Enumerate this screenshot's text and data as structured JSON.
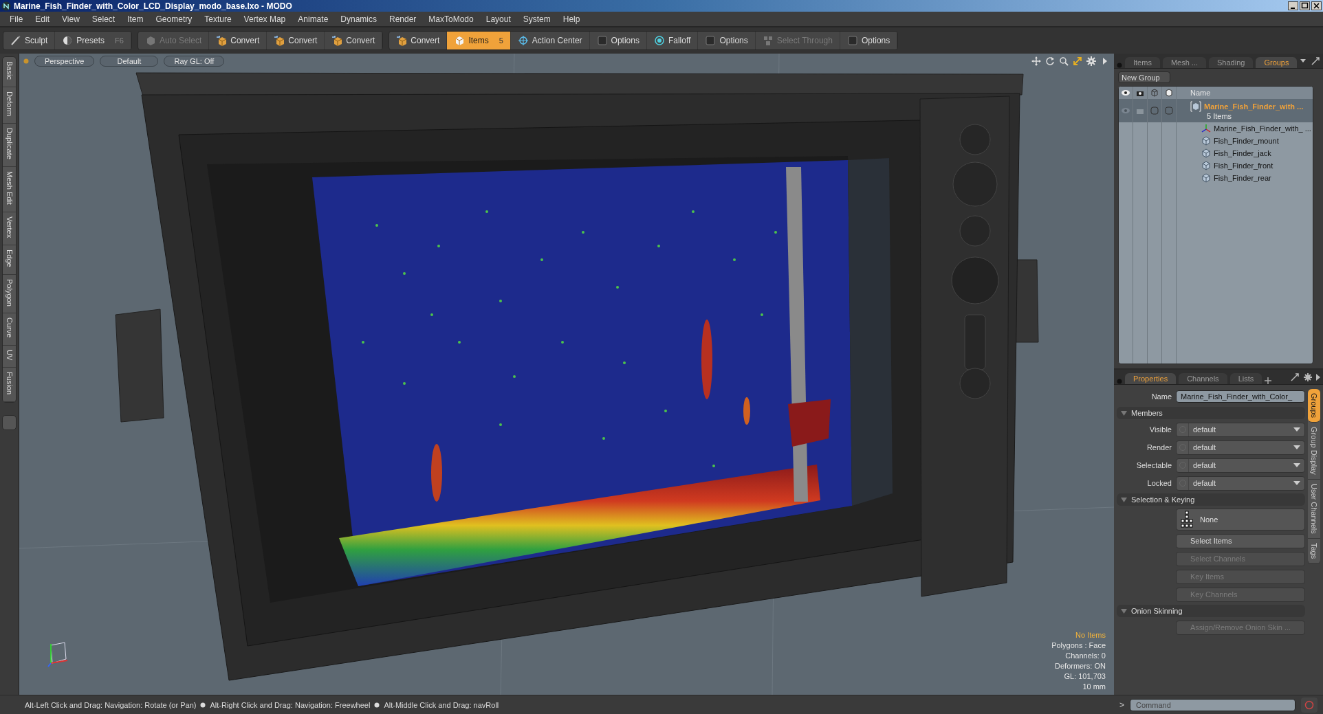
{
  "window": {
    "title": "Marine_Fish_Finder_with_Color_LCD_Display_modo_base.lxo - MODO"
  },
  "menu": [
    "File",
    "Edit",
    "View",
    "Select",
    "Item",
    "Geometry",
    "Texture",
    "Vertex Map",
    "Animate",
    "Dynamics",
    "Render",
    "MaxToModo",
    "Layout",
    "System",
    "Help"
  ],
  "toolbar": {
    "groups": [
      [
        {
          "kind": "sculpt",
          "label": "Sculpt",
          "selected": false,
          "disabled": false
        },
        {
          "kind": "presets",
          "label": "Presets",
          "shortcut": "F6",
          "selected": false,
          "disabled": false
        }
      ],
      [
        {
          "kind": "select",
          "label": "Auto Select",
          "selected": false,
          "disabled": true
        },
        {
          "kind": "convert",
          "label": "Convert",
          "selected": false,
          "disabled": false
        },
        {
          "kind": "convert",
          "label": "Convert",
          "selected": false,
          "disabled": false
        },
        {
          "kind": "convert",
          "label": "Convert",
          "selected": false,
          "disabled": false
        }
      ],
      [
        {
          "kind": "convert",
          "label": "Convert",
          "selected": false,
          "disabled": false
        },
        {
          "kind": "items",
          "label": "Items",
          "shortcut": "5",
          "selected": true,
          "disabled": false
        },
        {
          "kind": "action_center",
          "label": "Action Center",
          "selected": false,
          "disabled": false
        },
        {
          "kind": "options",
          "label": "Options",
          "selected": false,
          "disabled": false
        },
        {
          "kind": "falloff",
          "label": "Falloff",
          "selected": false,
          "disabled": false
        },
        {
          "kind": "options",
          "label": "Options",
          "selected": false,
          "disabled": false
        },
        {
          "kind": "select_through",
          "label": "Select Through",
          "selected": false,
          "disabled": true
        },
        {
          "kind": "options",
          "label": "Options",
          "selected": false,
          "disabled": false
        }
      ]
    ]
  },
  "side_tabs": [
    "Basic",
    "Deform",
    "Duplicate",
    "Mesh Edit",
    "Vertex",
    "Edge",
    "Polygon",
    "Curve",
    "UV",
    "Fusion"
  ],
  "viewport": {
    "header": [
      "Perspective",
      "Default",
      "Ray GL: Off"
    ],
    "info": [
      {
        "text": "No Items",
        "highlight": true
      },
      {
        "text": "Polygons : Face",
        "highlight": false
      },
      {
        "text": "Channels: 0",
        "highlight": false
      },
      {
        "text": "Deformers: ON",
        "highlight": false
      },
      {
        "text": "GL: 101,703",
        "highlight": false
      },
      {
        "text": "10 mm",
        "highlight": false
      }
    ]
  },
  "status_bar": {
    "hints": [
      "Alt-Left Click and Drag: Navigation: Rotate (or Pan)",
      "Alt-Right Click and Drag: Navigation: Freewheel",
      "Alt-Middle Click and Drag: navRoll"
    ]
  },
  "items_panel": {
    "tabs": [
      {
        "label": "Items",
        "selected": false
      },
      {
        "label": "Mesh ...",
        "selected": false
      },
      {
        "label": "Shading",
        "selected": false
      },
      {
        "label": "Groups",
        "selected": true
      }
    ],
    "new_group": "New Group",
    "name_column": "Name",
    "tree": [
      {
        "kind": "group",
        "name": "Marine_Fish_Finder_with ...",
        "count": "5 Items",
        "selected": true,
        "children": [
          {
            "kind": "locator",
            "name": "Marine_Fish_Finder_with_  ...",
            "selected": false
          },
          {
            "kind": "mesh",
            "name": "Fish_Finder_mount",
            "selected": false
          },
          {
            "kind": "mesh",
            "name": "Fish_Finder_jack",
            "selected": false
          },
          {
            "kind": "mesh",
            "name": "Fish_Finder_front",
            "selected": false
          },
          {
            "kind": "mesh",
            "name": "Fish_Finder_rear",
            "selected": false
          }
        ]
      }
    ]
  },
  "properties_panel": {
    "tabs": [
      {
        "label": "Properties",
        "selected": true
      },
      {
        "label": "Channels",
        "selected": false
      },
      {
        "label": "Lists",
        "selected": false
      }
    ],
    "name_field": {
      "label": "Name",
      "value": "Marine_Fish_Finder_with_Color_"
    },
    "sections": [
      {
        "title": "Members",
        "expanded": true,
        "rows": [
          {
            "kind": "dropdown",
            "label": "Visible",
            "value": "default"
          },
          {
            "kind": "dropdown",
            "label": "Render",
            "value": "default"
          },
          {
            "kind": "dropdown",
            "label": "Selectable",
            "value": "default"
          },
          {
            "kind": "dropdown",
            "label": "Locked",
            "value": "default"
          }
        ]
      },
      {
        "title": "Selection & Keying",
        "expanded": true,
        "rows": [
          {
            "kind": "picker",
            "value": "None"
          },
          {
            "kind": "button",
            "label": "Select Items",
            "disabled": false
          },
          {
            "kind": "button",
            "label": "Select Channels",
            "disabled": true
          },
          {
            "kind": "button",
            "label": "Key Items",
            "disabled": true
          },
          {
            "kind": "button",
            "label": "Key Channels",
            "disabled": true
          }
        ]
      },
      {
        "title": "Onion Skinning",
        "expanded": true,
        "rows": [
          {
            "kind": "button",
            "label": "Assign/Remove Onion Skin ...",
            "disabled": true
          }
        ]
      }
    ],
    "side_tabs": [
      {
        "label": "Groups",
        "selected": true
      },
      {
        "label": "Group Display",
        "selected": false
      },
      {
        "label": "User Channels",
        "selected": false
      },
      {
        "label": "Tags",
        "selected": false
      }
    ]
  },
  "command": {
    "prompt": ">",
    "placeholder": "Command"
  }
}
